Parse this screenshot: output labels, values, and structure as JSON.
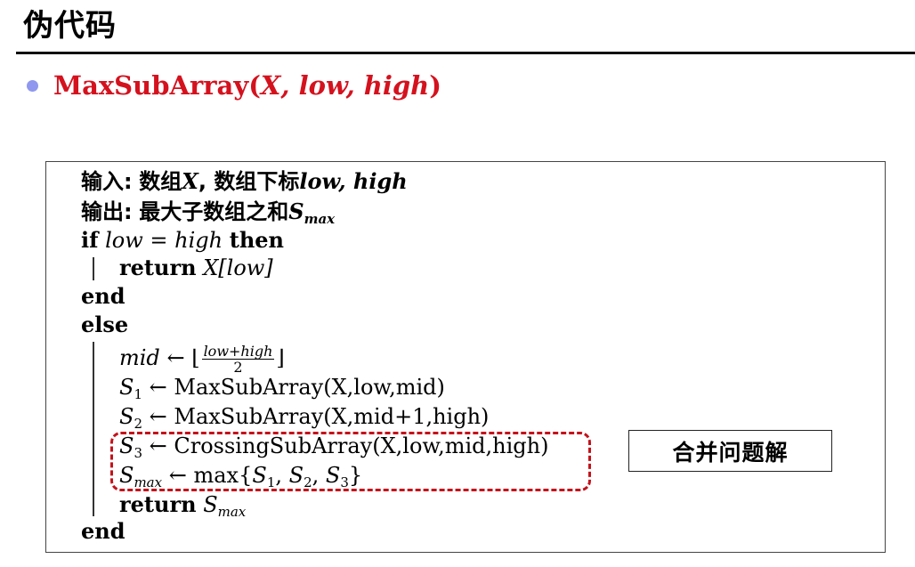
{
  "header": {
    "title": "伪代码"
  },
  "bullet": {
    "func_name": "MaxSubArray",
    "open_paren": "(",
    "args": "X, low, high",
    "close_paren": ")"
  },
  "algorithm": {
    "input_label": "输入:",
    "input_text_1": "数组",
    "input_var_1": "X",
    "input_text_2": ", 数组下标",
    "input_var_2": "low, high",
    "output_label": "输出:",
    "output_text": "最大子数组之和",
    "output_var": "S",
    "output_sub": "max",
    "if_kw": "if",
    "cond": "low = high",
    "then_kw": "then",
    "return_kw": "return",
    "return_expr": "X[low]",
    "end_kw": "end",
    "else_kw": "else",
    "mid_var": "mid",
    "arrow": "←",
    "floor_open": "⌊",
    "frac_num": "low+high",
    "frac_den": "2",
    "floor_close": "⌋",
    "s_var": "S",
    "s1_sub": "1",
    "s1_expr": "MaxSubArray(X,low,mid)",
    "s2_sub": "2",
    "s2_expr": "MaxSubArray(X,mid+1,high)",
    "s3_sub": "3",
    "s3_expr": "CrossingSubArray(X,low,mid,high)",
    "smax_sub": "max",
    "max_fn": "max",
    "set_open": "{",
    "set_items": "S",
    "comma": ", ",
    "set_close": "}",
    "return2_kw": "return",
    "end2_kw": "end"
  },
  "annotation": {
    "label": "合并问题解"
  },
  "colors": {
    "accent_red": "#d4121e",
    "bullet_blue": "#8f98ee"
  }
}
